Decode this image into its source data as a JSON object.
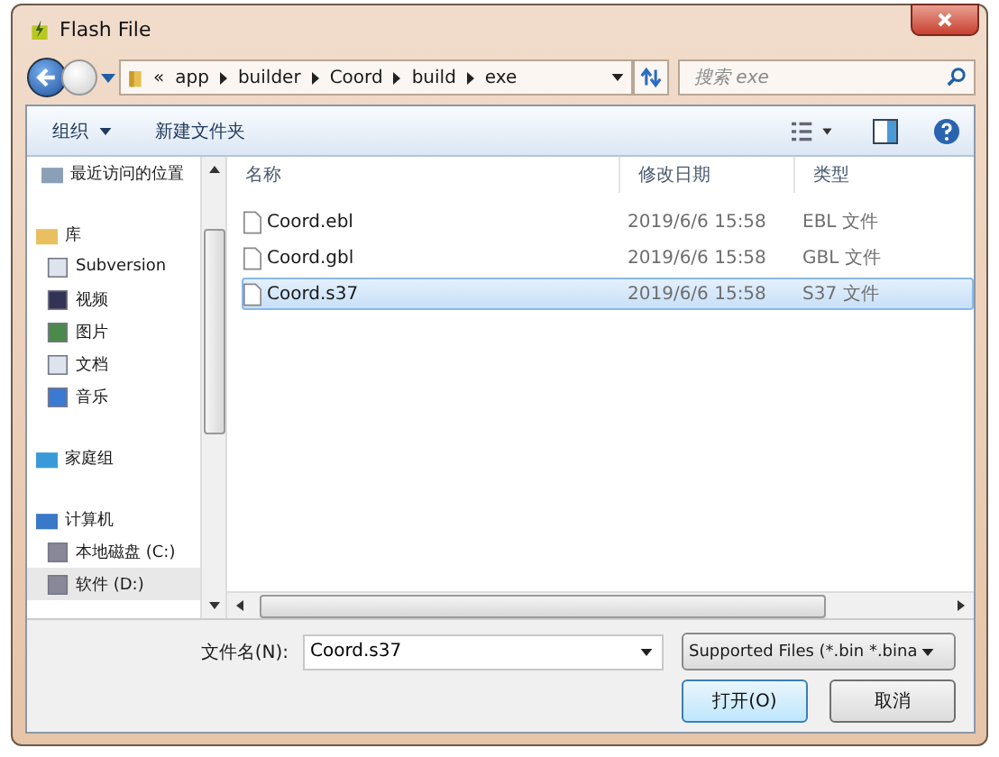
{
  "window": {
    "title": "Flash File"
  },
  "breadcrumb": {
    "overflow": "«",
    "segments": [
      "app",
      "builder",
      "Coord",
      "build",
      "exe"
    ]
  },
  "search": {
    "placeholder": "搜索 exe"
  },
  "toolbar": {
    "organize": "组织",
    "new_folder": "新建文件夹"
  },
  "sidebar": {
    "items": [
      {
        "label": "最近访问的位置",
        "selected": false
      },
      {
        "label": "库",
        "selected": false,
        "children": [
          {
            "label": "Subversion",
            "selected": false
          },
          {
            "label": "视频",
            "selected": false
          },
          {
            "label": "图片",
            "selected": false
          },
          {
            "label": "文档",
            "selected": false
          },
          {
            "label": "音乐",
            "selected": false
          }
        ]
      },
      {
        "label": "家庭组",
        "selected": false
      },
      {
        "label": "计算机",
        "selected": false,
        "children": [
          {
            "label": "本地磁盘 (C:)",
            "selected": false
          },
          {
            "label": "软件 (D:)",
            "selected": true
          }
        ]
      }
    ]
  },
  "table": {
    "columns": [
      "名称",
      "修改日期",
      "类型"
    ],
    "rows": [
      {
        "name": "Coord.ebl",
        "date": "2019/6/6 15:58",
        "type": "EBL 文件",
        "selected": false
      },
      {
        "name": "Coord.gbl",
        "date": "2019/6/6 15:58",
        "type": "GBL 文件",
        "selected": false
      },
      {
        "name": "Coord.s37",
        "date": "2019/6/6 15:58",
        "type": "S37 文件",
        "selected": true
      }
    ]
  },
  "filename": {
    "label": "文件名(N):",
    "value": "Coord.s37"
  },
  "filter": {
    "value": "Supported Files (*.bin *.bina"
  },
  "buttons": [
    {
      "label": "打开(O)",
      "kind": "primary"
    },
    {
      "label": "取消",
      "kind": "normal"
    }
  ]
}
